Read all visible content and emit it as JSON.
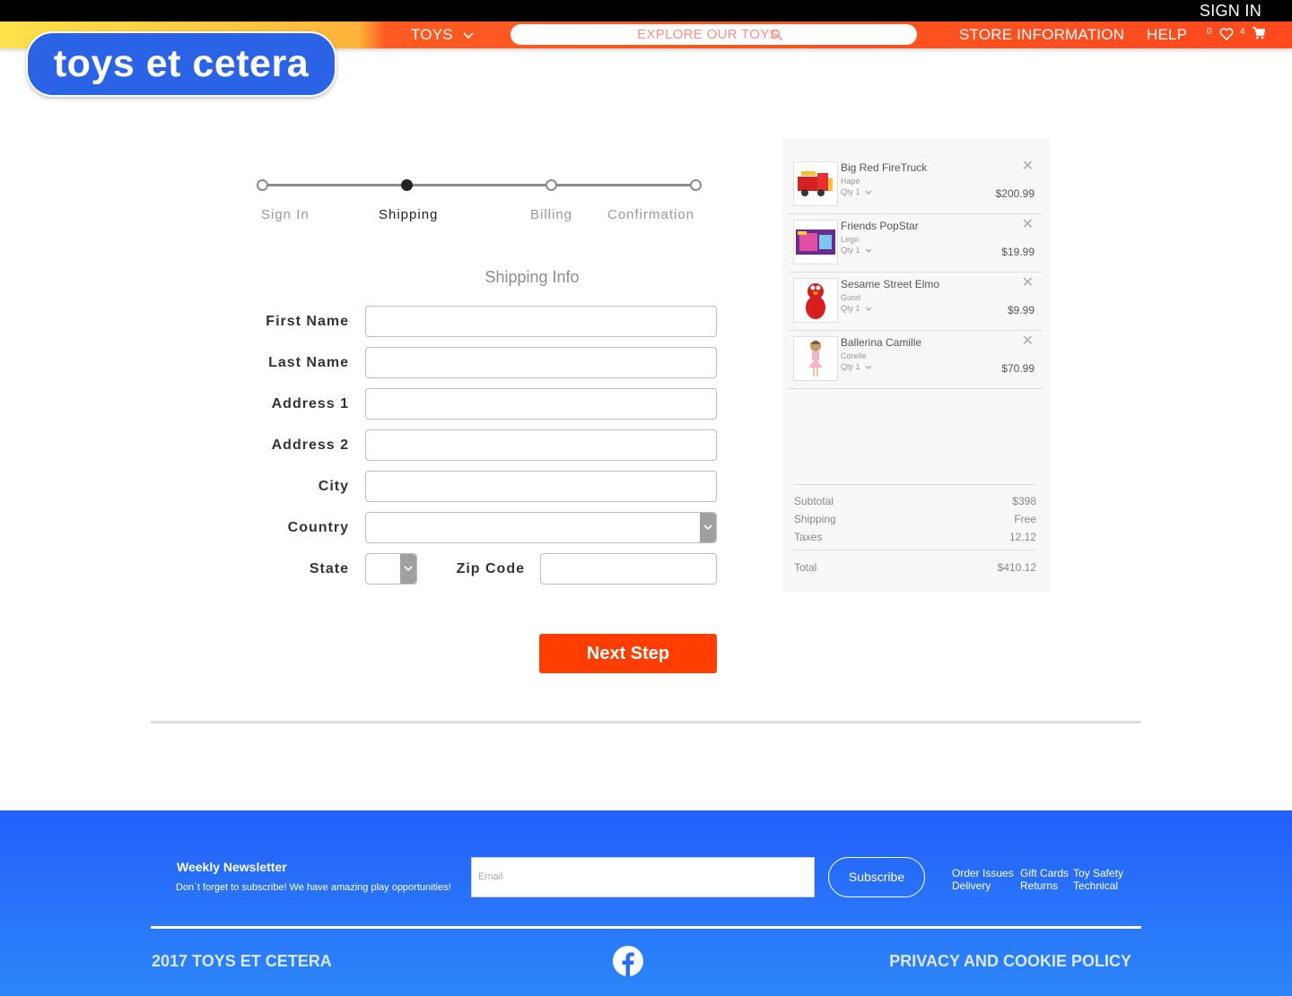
{
  "header": {
    "sign_in": "SIGN IN",
    "nav_toys": "TOYS",
    "search_placeholder": "EXPLORE OUR TOYS",
    "store_info": "STORE INFORMATION",
    "help": "HELP",
    "wishlist_count": "0",
    "cart_count": "4",
    "logo_text": "toys et cetera",
    "brand_colors": {
      "nav_orange": "#ff4a1e",
      "logo_blue": "#2b63e6",
      "accent": "#ff3d00"
    }
  },
  "progress": {
    "steps": [
      {
        "label": "Sign In",
        "active": false
      },
      {
        "label": "Shipping",
        "active": true
      },
      {
        "label": "Billing",
        "active": false
      },
      {
        "label": "Confirmation",
        "active": false
      }
    ]
  },
  "form": {
    "title": "Shipping Info",
    "first_name": {
      "label": "First Name",
      "value": ""
    },
    "last_name": {
      "label": "Last Name",
      "value": ""
    },
    "address1": {
      "label": "Address 1",
      "value": ""
    },
    "address2": {
      "label": "Address 2",
      "value": ""
    },
    "city": {
      "label": "City",
      "value": ""
    },
    "country": {
      "label": "Country",
      "value": ""
    },
    "state": {
      "label": "State",
      "value": ""
    },
    "zip": {
      "label": "Zip Code",
      "value": ""
    },
    "next_button": "Next Step"
  },
  "cart": {
    "items": [
      {
        "name": "Big Red FireTruck",
        "brand": "Hape",
        "qty": "Qty 1",
        "price": "$200.99"
      },
      {
        "name": "Friends PopStar",
        "brand": "Lego",
        "qty": "Qty 1",
        "price": "$19.99"
      },
      {
        "name": "Sesame Street Elmo",
        "brand": "Gund",
        "qty": "Qty 1",
        "price": "$9.99"
      },
      {
        "name": "Ballerina Camille",
        "brand": "Corelle",
        "qty": "Qty 1",
        "price": "$70.99"
      }
    ],
    "subtotal_label": "Subtotal",
    "subtotal": "$398",
    "shipping_label": "Shipping",
    "shipping": "Free",
    "taxes_label": "Taxes",
    "taxes": "12.12",
    "total_label": "Total",
    "total": "$410.12"
  },
  "footer": {
    "newsletter_title": "Weekly Newsletter",
    "newsletter_text": "Don`t forget to subscribe! We have amazing play opportunities!",
    "email_placeholder": "Email",
    "subscribe": "Subscribe",
    "links": {
      "order_issues": "Order Issues",
      "delivery": "Delivery",
      "gift_cards": "Gift Cards",
      "returns": "Returns",
      "toy_safety": "Toy Safety",
      "technical": "Technical"
    },
    "copyright": "2017 TOYS ET CETERA",
    "privacy": "PRIVACY AND COOKIE POLICY"
  }
}
